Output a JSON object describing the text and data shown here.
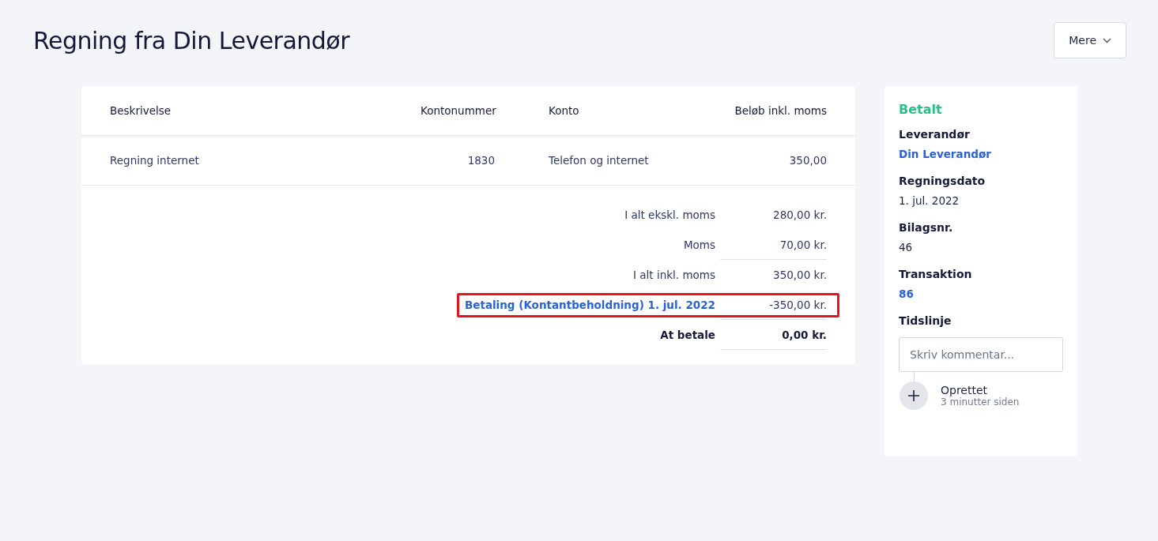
{
  "title": "Regning fra Din Leverandør",
  "more_button": {
    "label": "Mere"
  },
  "table": {
    "columns": [
      "Beskrivelse",
      "Kontonummer",
      "Konto",
      "Beløb inkl. moms"
    ],
    "rows": [
      {
        "cells": [
          "Regning internet",
          "1830",
          "Telefon og internet",
          "350,00"
        ]
      }
    ]
  },
  "summary": [
    {
      "label": "I alt ekskl. moms",
      "value": "280,00 kr.",
      "kind": "normal",
      "underlined": false,
      "highlighted": false
    },
    {
      "label": "Moms",
      "value": "70,00 kr.",
      "kind": "normal",
      "underlined": true,
      "highlighted": false
    },
    {
      "label": "I alt inkl. moms",
      "value": "350,00 kr.",
      "kind": "normal",
      "underlined": false,
      "highlighted": false
    },
    {
      "label": "Betaling (Kontantbeholdning) 1. jul. 2022",
      "value": "-350,00 kr.",
      "kind": "link",
      "underlined": true,
      "highlighted": true
    },
    {
      "label": "At betale",
      "value": "0,00 kr.",
      "kind": "total",
      "underlined": true,
      "highlighted": false
    }
  ],
  "sidebar": {
    "status": {
      "label": "Betalt",
      "color": "#2bbd85"
    },
    "fields": [
      {
        "label": "Leverandør",
        "value": "Din Leverandør",
        "kind": "link"
      },
      {
        "label": "Regningsdato",
        "value": "1. jul. 2022",
        "kind": "text"
      },
      {
        "label": "Bilagsnr.",
        "value": "46",
        "kind": "text"
      },
      {
        "label": "Transaktion",
        "value": "86",
        "kind": "link"
      }
    ],
    "timeline": {
      "heading": "Tidslinje",
      "comment_placeholder": "Skriv kommentar...",
      "events": [
        {
          "title": "Oprettet",
          "time": "3 minutter siden"
        }
      ]
    }
  }
}
